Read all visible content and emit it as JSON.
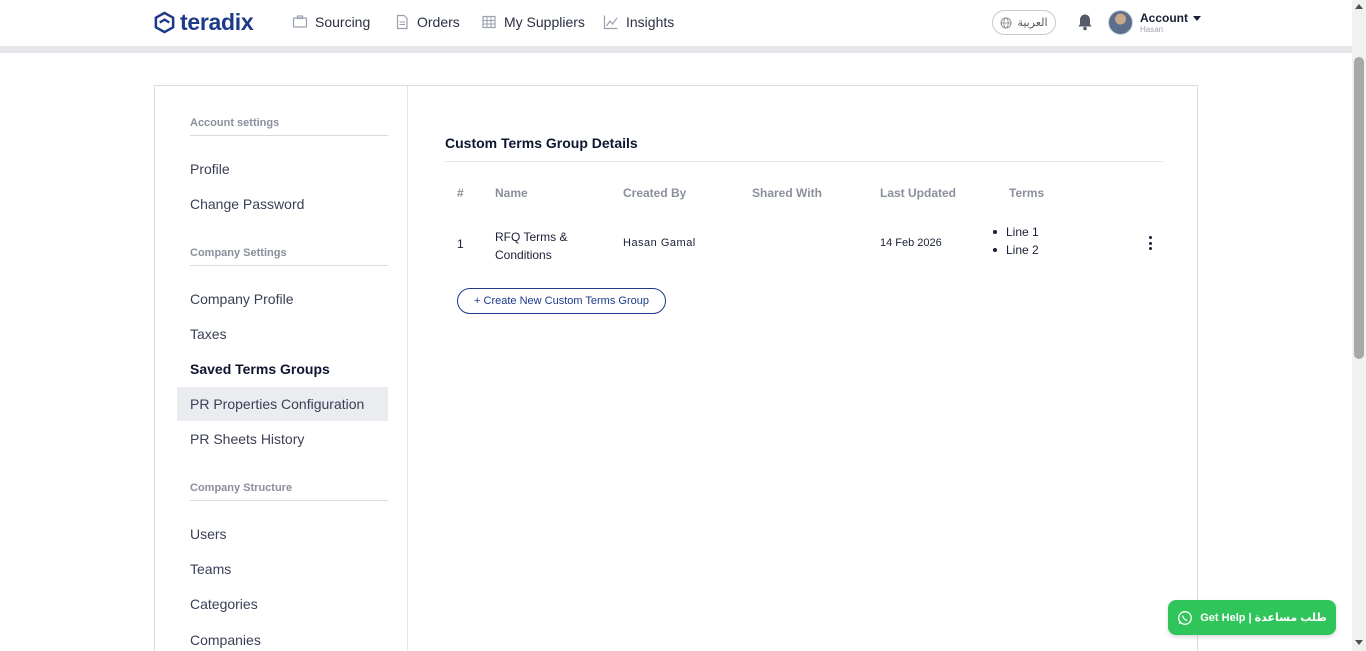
{
  "header": {
    "logo_text": "teradix",
    "nav": [
      {
        "label": "Sourcing",
        "icon": "sourcing-icon"
      },
      {
        "label": "Orders",
        "icon": "orders-icon"
      },
      {
        "label": "My Suppliers",
        "icon": "suppliers-icon"
      },
      {
        "label": "Insights",
        "icon": "insights-icon"
      }
    ],
    "language_label": "العربية",
    "account_label": "Account",
    "account_user": "Hasan"
  },
  "sidebar": {
    "sections": [
      {
        "title": "Account settings",
        "items": [
          "Profile",
          "Change Password"
        ]
      },
      {
        "title": "Company Settings",
        "items": [
          "Company Profile",
          "Taxes",
          "Saved Terms Groups",
          "PR Properties Configuration",
          "PR Sheets History"
        ]
      },
      {
        "title": "Company Structure",
        "items": [
          "Users",
          "Teams",
          "Categories",
          "Companies"
        ]
      }
    ],
    "active_item": "Saved Terms Groups",
    "hover_item": "PR Properties Configuration"
  },
  "main": {
    "title": "Custom Terms Group Details",
    "columns": [
      "#",
      "Name",
      "Created By",
      "Shared With",
      "Last Updated",
      "Terms"
    ],
    "rows": [
      {
        "index": "1",
        "name_line1": "RFQ Terms &",
        "name_line2": "Conditions",
        "created_by": "Hasan Gamal",
        "shared_with": "",
        "last_updated": "14 Feb 2026",
        "terms": [
          "Line 1",
          "Line 2"
        ]
      }
    ],
    "create_button": "+ Create New Custom Terms Group"
  },
  "help_button": "Get Help | طلب مساعدة",
  "colors": {
    "brand": "#1d3a8a",
    "help_green": "#2fc55b",
    "muted": "#8a8f9c"
  }
}
